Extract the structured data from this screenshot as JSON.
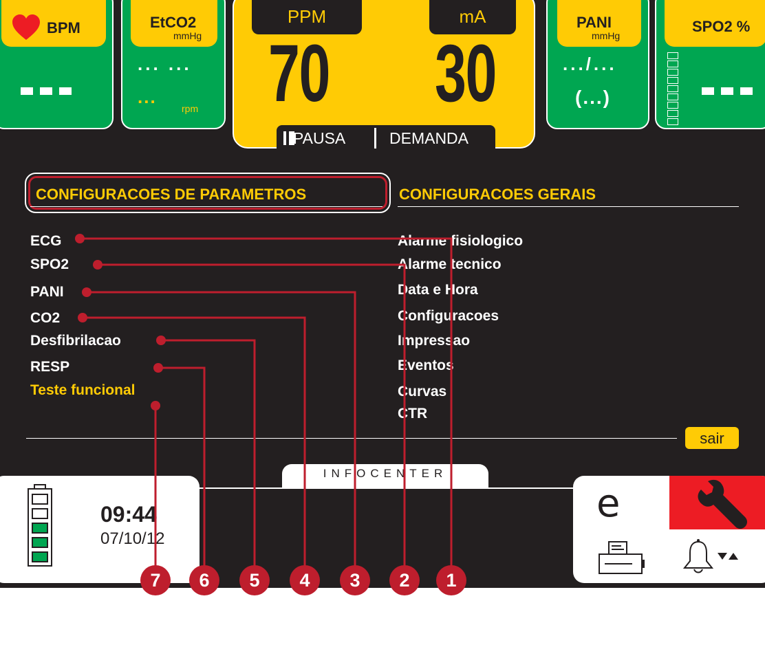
{
  "panels": {
    "bpm": {
      "label": "BPM",
      "value": "■ ■ ■"
    },
    "etco2": {
      "label": "EtCO2",
      "unit": "mmHg",
      "value": "... ...",
      "resp_value": "...",
      "resp_unit": "rpm"
    },
    "pani": {
      "label": "PANI",
      "unit": "mmHg",
      "value": ".../...",
      "mean": "(...)"
    },
    "spo2": {
      "label": "SPO2 %",
      "value": "■ ■ ■"
    }
  },
  "pacer": {
    "ppm_label": "PPM",
    "ppm_value": "70",
    "ma_label": "mA",
    "ma_value": "30",
    "pause_label": "PAUSA",
    "mode_label": "DEMANDA"
  },
  "menu": {
    "left_title": "CONFIGURACOES DE PARAMETROS",
    "right_title": "CONFIGURACOES GERAIS",
    "left_items": [
      "ECG",
      "SPO2",
      "PANI",
      "CO2",
      "Desfibrilacao",
      "RESP",
      "Teste funcional"
    ],
    "right_items": [
      "Alarme fisiologico",
      "Alarme tecnico",
      "Data e Hora",
      "Configuracoes",
      "Impressao",
      "Eventos",
      "Curvas",
      "CTR"
    ],
    "exit_label": "sair"
  },
  "status_bar": {
    "infocenter_label": "INFOCENTER",
    "time": "09:44",
    "date": "07/10/12",
    "battery_bars_filled": 3,
    "battery_bars_total": 5
  },
  "callouts": [
    "7",
    "6",
    "5",
    "4",
    "3",
    "2",
    "1"
  ],
  "colors": {
    "background": "#231f20",
    "panel_green": "#00a651",
    "accent_yellow": "#ffcb05",
    "callout_red": "#be1e2d",
    "alert_red": "#ed1c24"
  }
}
